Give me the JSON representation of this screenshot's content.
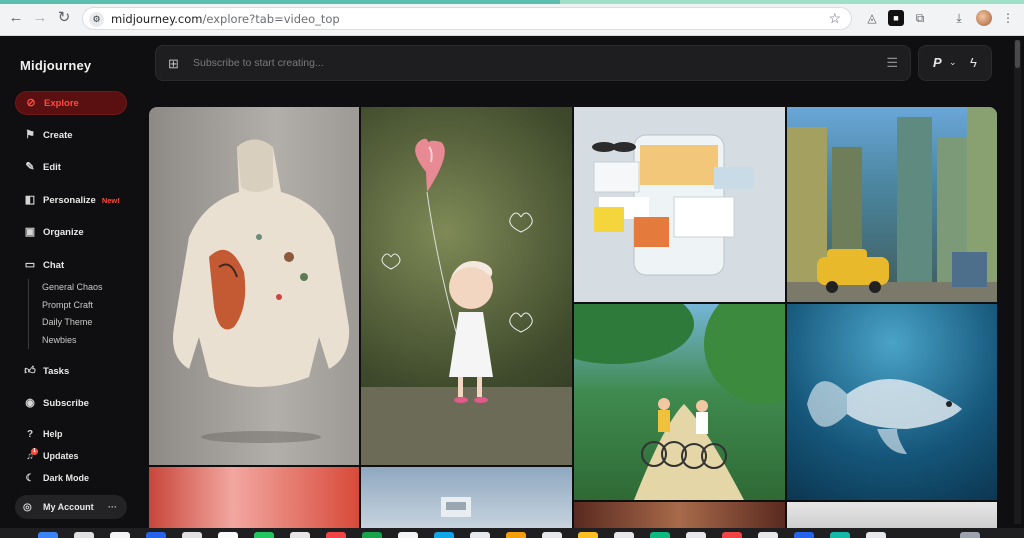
{
  "browser": {
    "url_host": "midjourney.com",
    "url_path": "/explore?tab=video_top",
    "back_icon": "back-arrow-icon",
    "forward_icon": "forward-arrow-icon",
    "reload_icon": "reload-icon"
  },
  "app": {
    "brand": "Midjourney",
    "accent": "#ff4b3e",
    "nav": [
      {
        "label": "Explore",
        "icon": "compass-icon",
        "active": true
      },
      {
        "label": "Create",
        "icon": "brush-icon"
      },
      {
        "label": "Edit",
        "icon": "edit-icon"
      },
      {
        "label": "Personalize",
        "icon": "personalize-icon",
        "badge": "New!"
      },
      {
        "label": "Organize",
        "icon": "image-icon"
      },
      {
        "label": "Chat",
        "icon": "chat-icon"
      }
    ],
    "chat_channels": [
      "General Chaos",
      "Prompt Craft",
      "Daily Theme",
      "Newbies"
    ],
    "nav2": [
      {
        "label": "Tasks",
        "icon": "thumbs-up-icon"
      },
      {
        "label": "Subscribe",
        "icon": "subscribe-icon"
      }
    ],
    "bottom": [
      {
        "label": "Help",
        "icon": "help-icon"
      },
      {
        "label": "Updates",
        "icon": "bell-icon",
        "badge": "1"
      },
      {
        "label": "Dark Mode",
        "icon": "moon-icon"
      }
    ],
    "account": {
      "label": "My Account",
      "more": "···"
    }
  },
  "prompt": {
    "placeholder": "Subscribe to start creating...",
    "version_label": "P",
    "chevron": "⌄"
  }
}
